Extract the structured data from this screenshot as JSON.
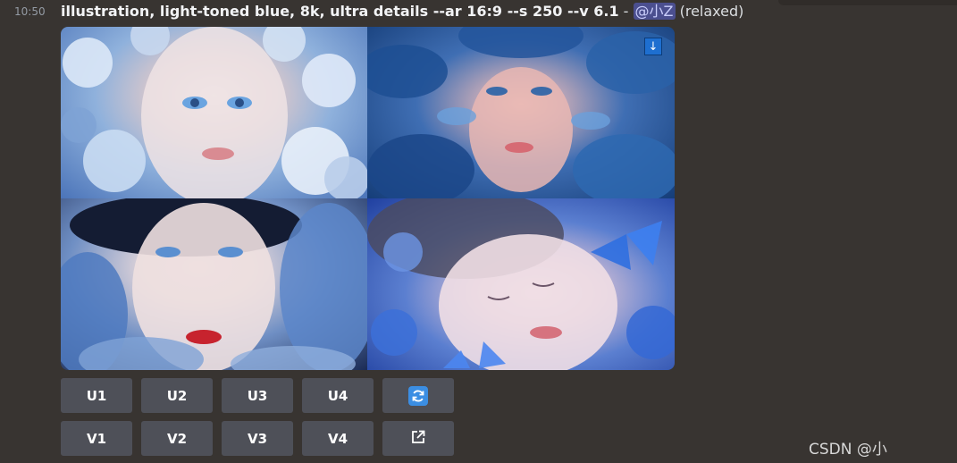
{
  "message": {
    "time": "10:50",
    "prompt": "illustration, light-toned blue, 8k, ultra details --ar 16:9 --s 250 --v 6.1",
    "separator": " - ",
    "mention": "@小Z",
    "status": "(relaxed)"
  },
  "image_grid": {
    "download_symbol": "↓"
  },
  "buttons": {
    "upscale": [
      "U1",
      "U2",
      "U3",
      "U4"
    ],
    "variation": [
      "V1",
      "V2",
      "V3",
      "V4"
    ],
    "reroll_icon": "refresh-icon",
    "open_icon": "external-link-icon"
  },
  "watermark": "CSDN @小"
}
